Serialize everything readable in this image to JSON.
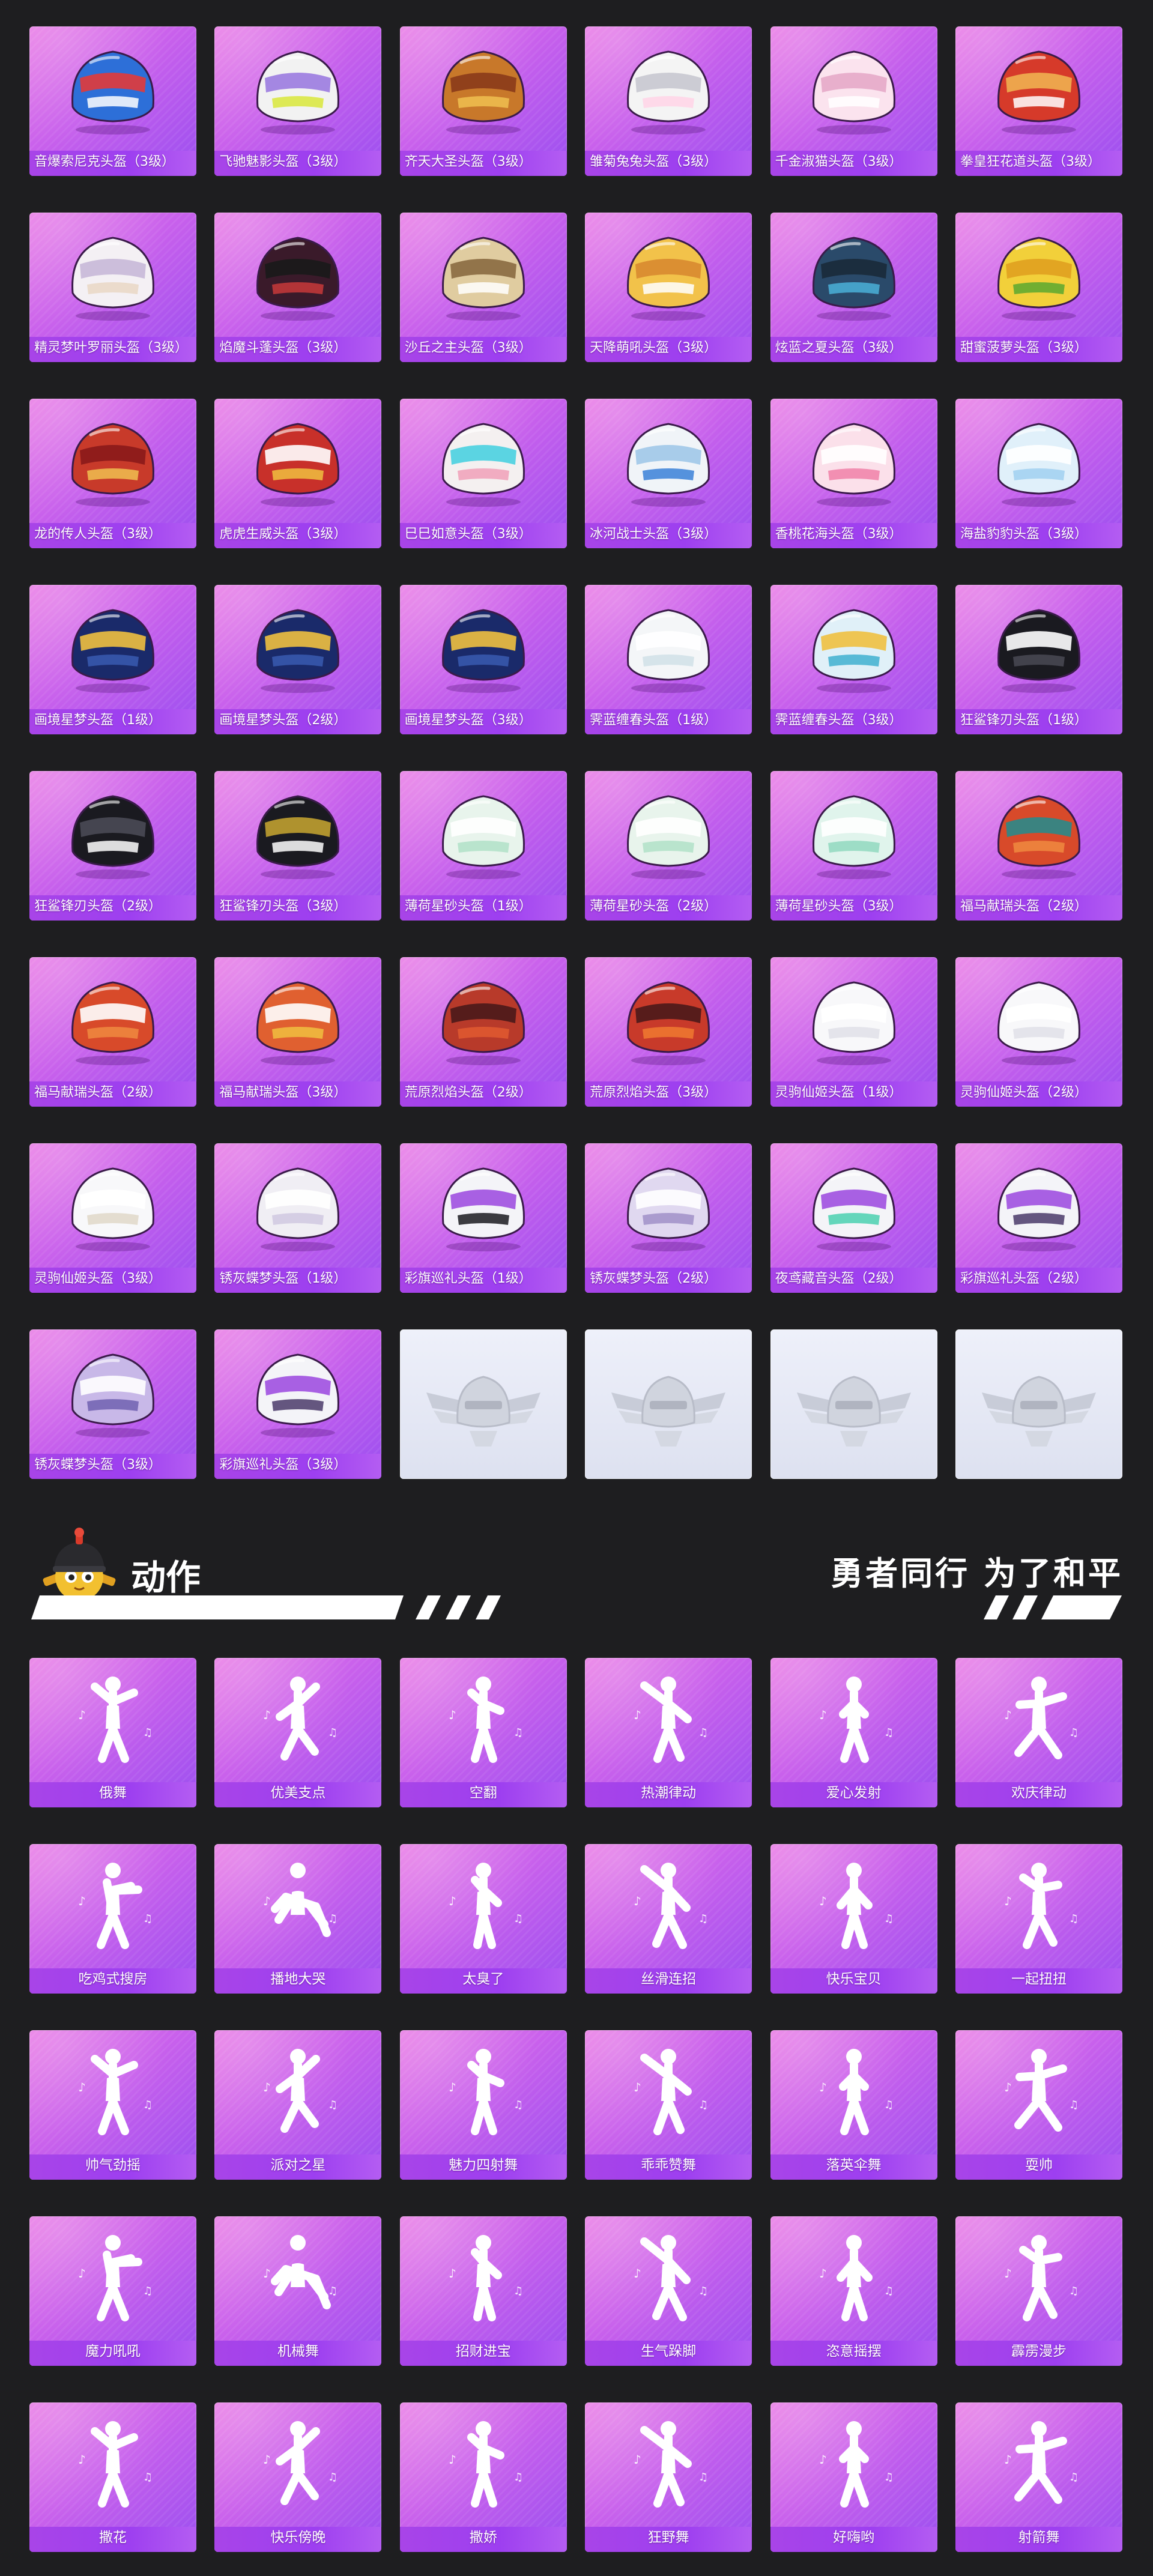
{
  "helmets": {
    "items": [
      {
        "label": "音爆索尼克头盔（3级）",
        "colors": [
          "#2d6fd8",
          "#ffffff",
          "#e23a3a"
        ],
        "icon": "helmet-icon"
      },
      {
        "label": "飞驰魅影头盔（3级）",
        "colors": [
          "#f2f2f2",
          "#d9e83a",
          "#9b7be0"
        ],
        "icon": "helmet-icon"
      },
      {
        "label": "齐天大圣头盔（3级）",
        "colors": [
          "#c8782a",
          "#f0c050",
          "#8a3a1a"
        ],
        "icon": "helmet-icon"
      },
      {
        "label": "雏菊兔兔头盔（3级）",
        "colors": [
          "#f4f4f4",
          "#ffd3e6",
          "#c8c8d0"
        ],
        "icon": "helmet-icon"
      },
      {
        "label": "千金淑猫头盔（3级）",
        "colors": [
          "#fbe3ee",
          "#ffffff",
          "#e5a9c8"
        ],
        "icon": "helmet-icon"
      },
      {
        "label": "拳皇狂花道头盔（3级）",
        "colors": [
          "#d63a2a",
          "#ffffff",
          "#f0b050"
        ],
        "icon": "helmet-icon"
      },
      {
        "label": "精灵梦叶罗丽头盔（3级）",
        "colors": [
          "#f4f0f4",
          "#e9d7c4",
          "#c8b8d8"
        ],
        "icon": "helmet-icon"
      },
      {
        "label": "焰魔斗蓬头盔（3级）",
        "colors": [
          "#3a1a2a",
          "#c83a3a",
          "#1a1a1a"
        ],
        "icon": "helmet-icon"
      },
      {
        "label": "沙丘之主头盔（3级）",
        "colors": [
          "#e0cca0",
          "#ffffff",
          "#8a6a40"
        ],
        "icon": "helmet-icon"
      },
      {
        "label": "天降萌吼头盔（3级）",
        "colors": [
          "#f2c24a",
          "#ffffff",
          "#d88a30"
        ],
        "icon": "helmet-icon"
      },
      {
        "label": "炫蓝之夏头盔（3级）",
        "colors": [
          "#2a4a6a",
          "#4ab0d8",
          "#1a2a3a"
        ],
        "icon": "helmet-icon"
      },
      {
        "label": "甜蜜菠萝头盔（3级）",
        "colors": [
          "#f2d03a",
          "#5aa830",
          "#e0a020"
        ],
        "icon": "helmet-icon"
      },
      {
        "label": "龙的传人头盔（3级）",
        "colors": [
          "#c83a2a",
          "#f0c050",
          "#8a1a1a"
        ],
        "icon": "helmet-icon"
      },
      {
        "label": "虎虎生威头盔（3级）",
        "colors": [
          "#c8302a",
          "#f0c040",
          "#ffffff"
        ],
        "icon": "helmet-icon"
      },
      {
        "label": "巳巳如意头盔（3级）",
        "colors": [
          "#f4f0f0",
          "#f0a0b8",
          "#4ad0e0"
        ],
        "icon": "helmet-icon"
      },
      {
        "label": "冰河战士头盔（3级）",
        "colors": [
          "#f0f4f8",
          "#3a80d8",
          "#a0c8e8"
        ],
        "icon": "helmet-icon"
      },
      {
        "label": "香桃花海头盔（3级）",
        "colors": [
          "#fbe0ea",
          "#f080a8",
          "#ffffff"
        ],
        "icon": "helmet-icon"
      },
      {
        "label": "海盐豹豹头盔（3级）",
        "colors": [
          "#e0f0fa",
          "#a0d0f0",
          "#ffffff"
        ],
        "icon": "helmet-icon"
      },
      {
        "label": "画境星梦头盔（1级）",
        "colors": [
          "#1a2a6a",
          "#3a5ab0",
          "#f0c040"
        ],
        "icon": "helmet-icon"
      },
      {
        "label": "画境星梦头盔（2级）",
        "colors": [
          "#1a2a6a",
          "#3a5ab0",
          "#f0c040"
        ],
        "icon": "helmet-icon"
      },
      {
        "label": "画境星梦头盔（3级）",
        "colors": [
          "#1a2a6a",
          "#3a5ab0",
          "#f0c040"
        ],
        "icon": "helmet-icon"
      },
      {
        "label": "霁蓝缠春头盔（1级）",
        "colors": [
          "#f4f6f8",
          "#d0e0e8",
          "#ffffff"
        ],
        "icon": "helmet-icon"
      },
      {
        "label": "霁蓝缠春头盔（3级）",
        "colors": [
          "#e0f0f8",
          "#40b0d0",
          "#f0c040"
        ],
        "icon": "helmet-icon"
      },
      {
        "label": "狂鲨锋刃头盔（1级）",
        "colors": [
          "#1a1a20",
          "#4a4a55",
          "#ffffff"
        ],
        "icon": "helmet-icon"
      },
      {
        "label": "狂鲨锋刃头盔（2级）",
        "colors": [
          "#1a1a20",
          "#ffffff",
          "#4a4a55"
        ],
        "icon": "helmet-icon"
      },
      {
        "label": "狂鲨锋刃头盔（3级）",
        "colors": [
          "#1a1a20",
          "#ffffff",
          "#c0a030"
        ],
        "icon": "helmet-icon"
      },
      {
        "label": "薄荷星砂头盔（1级）",
        "colors": [
          "#e8f4ec",
          "#b0e0c8",
          "#ffffff"
        ],
        "icon": "helmet-icon"
      },
      {
        "label": "薄荷星砂头盔（2级）",
        "colors": [
          "#e8f4ec",
          "#b0e0c8",
          "#ffffff"
        ],
        "icon": "helmet-icon"
      },
      {
        "label": "薄荷星砂头盔（3级）",
        "colors": [
          "#e0f4ec",
          "#90d8c0",
          "#ffffff"
        ],
        "icon": "helmet-icon"
      },
      {
        "label": "福马献瑞头盔（2级）",
        "colors": [
          "#d84a2a",
          "#f08a40",
          "#2a8a8a"
        ],
        "icon": "helmet-icon"
      },
      {
        "label": "福马献瑞头盔（2级）",
        "colors": [
          "#d84a2a",
          "#f08a40",
          "#ffffff"
        ],
        "icon": "helmet-icon"
      },
      {
        "label": "福马献瑞头盔（3级）",
        "colors": [
          "#e06030",
          "#f0c040",
          "#ffffff"
        ],
        "icon": "helmet-icon"
      },
      {
        "label": "荒原烈焰头盔（2级）",
        "colors": [
          "#b83a2a",
          "#e05a30",
          "#4a1a1a"
        ],
        "icon": "helmet-icon"
      },
      {
        "label": "荒原烈焰头盔（3级）",
        "colors": [
          "#c83a2a",
          "#f07a30",
          "#4a1a1a"
        ],
        "icon": "helmet-icon"
      },
      {
        "label": "灵驹仙姬头盔（1级）",
        "colors": [
          "#f8f8fa",
          "#e0e0e8",
          "#ffffff"
        ],
        "icon": "helmet-icon"
      },
      {
        "label": "灵驹仙姬头盔（2级）",
        "colors": [
          "#f8f8fa",
          "#e0e0e8",
          "#ffffff"
        ],
        "icon": "helmet-icon"
      },
      {
        "label": "灵驹仙姬头盔（3级）",
        "colors": [
          "#f8f8fa",
          "#e0d8c8",
          "#ffffff"
        ],
        "icon": "helmet-icon"
      },
      {
        "label": "锈灰蝶梦头盔（1级）",
        "colors": [
          "#f0eef4",
          "#d0c8e0",
          "#ffffff"
        ],
        "icon": "helmet-icon"
      },
      {
        "label": "彩旗巡礼头盔（1级）",
        "colors": [
          "#f4f4f8",
          "#1a1a20",
          "#a050e0"
        ],
        "icon": "helmet-icon"
      },
      {
        "label": "锈灰蝶梦头盔（2级）",
        "colors": [
          "#e0d8f0",
          "#a090c8",
          "#ffffff"
        ],
        "icon": "helmet-icon"
      },
      {
        "label": "夜鸢藏音头盔（2级）",
        "colors": [
          "#f4f4f8",
          "#4ad0b0",
          "#a050e0"
        ],
        "icon": "helmet-icon"
      },
      {
        "label": "彩旗巡礼头盔（2级）",
        "colors": [
          "#f4f4f8",
          "#4a3a6a",
          "#a050e0"
        ],
        "icon": "helmet-icon"
      },
      {
        "label": "锈灰蝶梦头盔（3级）",
        "colors": [
          "#c8b8e8",
          "#7060b0",
          "#ffffff"
        ],
        "icon": "helmet-icon"
      },
      {
        "label": "彩旗巡礼头盔（3级）",
        "colors": [
          "#f4f4f8",
          "#4a3a6a",
          "#a050e0"
        ],
        "icon": "helmet-icon"
      }
    ],
    "placeholders": 4
  },
  "section": {
    "title": "动作",
    "slogan": "勇者同行 为了和平",
    "mascot_icon": "helmet-mascot-icon"
  },
  "emotes": {
    "items": [
      {
        "label": "俄舞",
        "pose": 0
      },
      {
        "label": "优美支点",
        "pose": 1
      },
      {
        "label": "空翻",
        "pose": 2
      },
      {
        "label": "热潮律动",
        "pose": 3
      },
      {
        "label": "爱心发射",
        "pose": 4
      },
      {
        "label": "欢庆律动",
        "pose": 5
      },
      {
        "label": "吃鸡式搜房",
        "pose": 6
      },
      {
        "label": "播地大哭",
        "pose": 7
      },
      {
        "label": "太臭了",
        "pose": 8
      },
      {
        "label": "丝滑连招",
        "pose": 9
      },
      {
        "label": "快乐宝贝",
        "pose": 10
      },
      {
        "label": "一起扭扭",
        "pose": 11
      },
      {
        "label": "帅气劲摇",
        "pose": 0
      },
      {
        "label": "派对之星",
        "pose": 1
      },
      {
        "label": "魅力四射舞",
        "pose": 2
      },
      {
        "label": "乖乖赞舞",
        "pose": 3
      },
      {
        "label": "落英伞舞",
        "pose": 4
      },
      {
        "label": "耍帅",
        "pose": 5
      },
      {
        "label": "魔力吼吼",
        "pose": 6
      },
      {
        "label": "机械舞",
        "pose": 7
      },
      {
        "label": "招财进宝",
        "pose": 8
      },
      {
        "label": "生气跺脚",
        "pose": 9
      },
      {
        "label": "恣意摇摆",
        "pose": 10
      },
      {
        "label": "霹雳漫步",
        "pose": 11
      },
      {
        "label": "撒花",
        "pose": 0
      },
      {
        "label": "快乐傍晚",
        "pose": 1
      },
      {
        "label": "撒娇",
        "pose": 2
      },
      {
        "label": "狂野舞",
        "pose": 3
      },
      {
        "label": "好嗨哟",
        "pose": 4
      },
      {
        "label": "射箭舞",
        "pose": 5
      }
    ]
  },
  "theme": {
    "card_gradient": [
      "#e97ce6",
      "#c860ec",
      "#9b4ff0"
    ],
    "label_bar": "#a844e8",
    "page_background": "#1e1e20",
    "placeholder_bg": "#e4e7f4"
  }
}
